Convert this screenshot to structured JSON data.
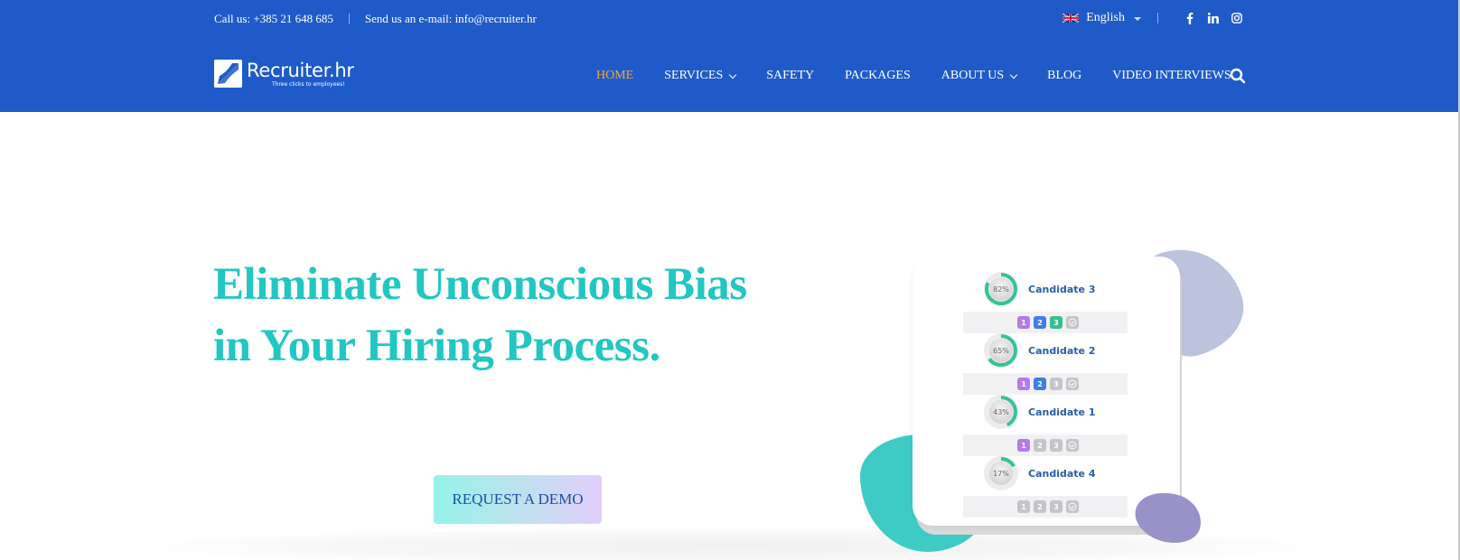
{
  "topbar": {
    "phone": "Call us: +385 21 648 685",
    "email": "Send us an e-mail: info@recruiter.hr",
    "language": "English",
    "language_flag": "uk-flag-icon",
    "social": [
      "facebook-icon",
      "linkedin-icon",
      "instagram-icon"
    ]
  },
  "brand": {
    "name": "Recruiter.hr",
    "tagline": "Three clicks to employees!"
  },
  "nav": {
    "items": [
      {
        "label": "HOME",
        "active": true,
        "dropdown": false
      },
      {
        "label": "SERVICES",
        "active": false,
        "dropdown": true
      },
      {
        "label": "SAFETY",
        "active": false,
        "dropdown": false
      },
      {
        "label": "PACKAGES",
        "active": false,
        "dropdown": false
      },
      {
        "label": "ABOUT US",
        "active": false,
        "dropdown": true
      },
      {
        "label": "BLOG",
        "active": false,
        "dropdown": false
      },
      {
        "label": "VIDEO INTERVIEWS",
        "active": false,
        "dropdown": false
      }
    ],
    "search_icon": "search-icon"
  },
  "hero": {
    "title_line1": "Eliminate Unconscious Bias",
    "title_line2": "in Your Hiring Process.",
    "cta_label": "REQUEST A DEMO"
  },
  "illustration": {
    "candidates": [
      {
        "name": "Candidate 3",
        "percent_label": "82%",
        "percent": 82,
        "steps_done": 3
      },
      {
        "name": "Candidate 2",
        "percent_label": "65%",
        "percent": 65,
        "steps_done": 2
      },
      {
        "name": "Candidate 1",
        "percent_label": "43%",
        "percent": 43,
        "steps_done": 1
      },
      {
        "name": "Candidate 4",
        "percent_label": "17%",
        "percent": 17,
        "steps_done": 0
      }
    ],
    "step_labels": [
      "1",
      "2",
      "3"
    ],
    "step_colors": [
      "#b57ae8",
      "#3f7ee6",
      "#35c08e"
    ],
    "ring_color": "#36c490"
  },
  "colors": {
    "header_bg": "#1f5bc8",
    "nav_active": "#f0a83c",
    "hero_title": "#22c6c2",
    "cta_text": "#1d4f9f"
  }
}
